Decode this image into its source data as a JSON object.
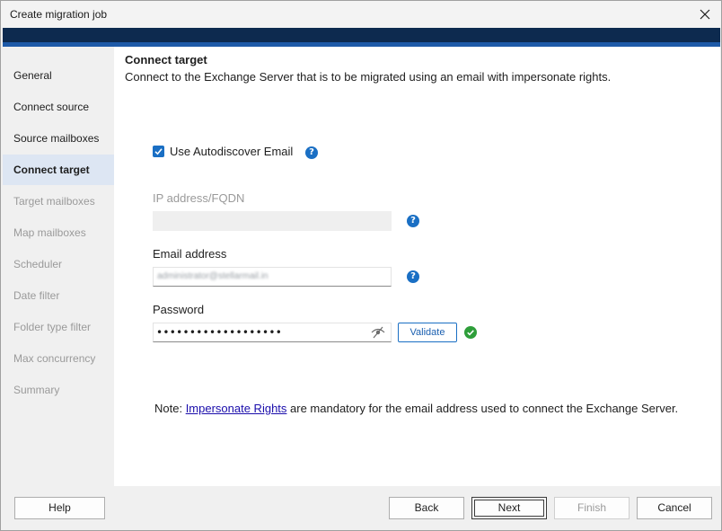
{
  "window": {
    "title": "Create migration job"
  },
  "sidebar": {
    "items": [
      {
        "label": "General",
        "state": "normal"
      },
      {
        "label": "Connect source",
        "state": "normal"
      },
      {
        "label": "Source mailboxes",
        "state": "normal"
      },
      {
        "label": "Connect target",
        "state": "active"
      },
      {
        "label": "Target mailboxes",
        "state": "disabled"
      },
      {
        "label": "Map mailboxes",
        "state": "disabled"
      },
      {
        "label": "Scheduler",
        "state": "disabled"
      },
      {
        "label": "Date filter",
        "state": "disabled"
      },
      {
        "label": "Folder type filter",
        "state": "disabled"
      },
      {
        "label": "Max concurrency",
        "state": "disabled"
      },
      {
        "label": "Summary",
        "state": "disabled"
      }
    ]
  },
  "main": {
    "heading": "Connect target",
    "description": "Connect to the Exchange Server that is to be migrated using an email with impersonate rights.",
    "autodiscover": {
      "label": "Use Autodiscover Email",
      "checked": true
    },
    "ip": {
      "label": "IP address/FQDN",
      "value": ""
    },
    "email": {
      "label": "Email address",
      "value": "administrator@stellarmail.in"
    },
    "password": {
      "label": "Password",
      "value": "•••••••••••••••••••"
    },
    "validate_label": "Validate",
    "note": {
      "prefix": "Note: ",
      "link": "Impersonate Rights",
      "suffix": " are mandatory for the email address used to connect the Exchange Server."
    }
  },
  "footer": {
    "help": "Help",
    "back": "Back",
    "next": "Next",
    "finish": "Finish",
    "cancel": "Cancel"
  },
  "colors": {
    "accent": "#1a6fc4",
    "header_dark": "#0d2a4f",
    "header_blue": "#1e5aa8",
    "active_item_bg": "#dde6f3",
    "success": "#2e9e3a"
  }
}
